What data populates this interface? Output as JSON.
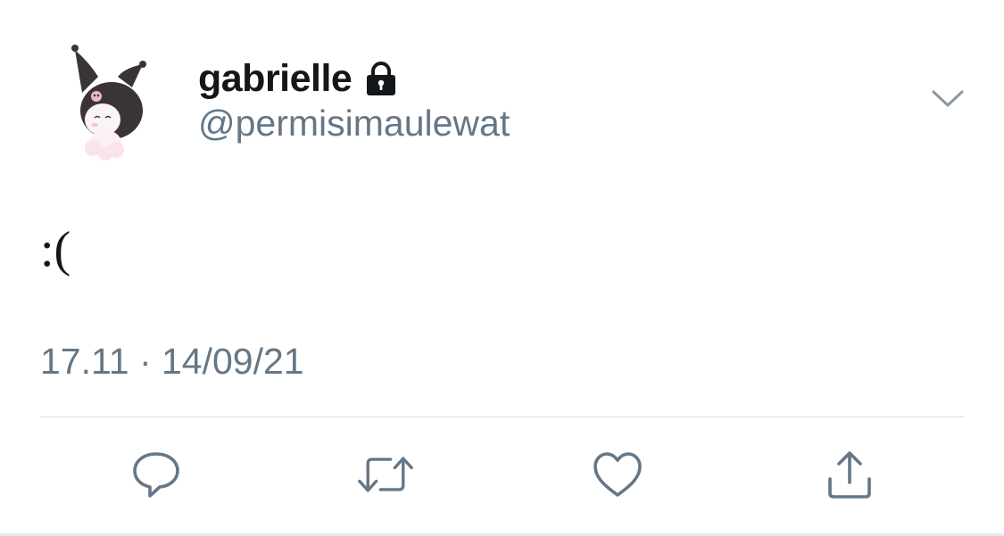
{
  "tweet": {
    "display_name": "gabrielle",
    "handle": "@permisimaulewat",
    "text": ":(",
    "timestamp": "17.11 · 14/09/21"
  },
  "icons": {
    "avatar": "kuromi-avatar",
    "protected": "lock-icon",
    "more": "chevron-down-icon",
    "reply": "reply-icon",
    "retweet": "retweet-icon",
    "like": "heart-icon",
    "share": "share-icon"
  },
  "colors": {
    "name_text": "#14171a",
    "secondary_text": "#657786",
    "icon_gray": "#657786",
    "divider": "#d6dbe0"
  }
}
